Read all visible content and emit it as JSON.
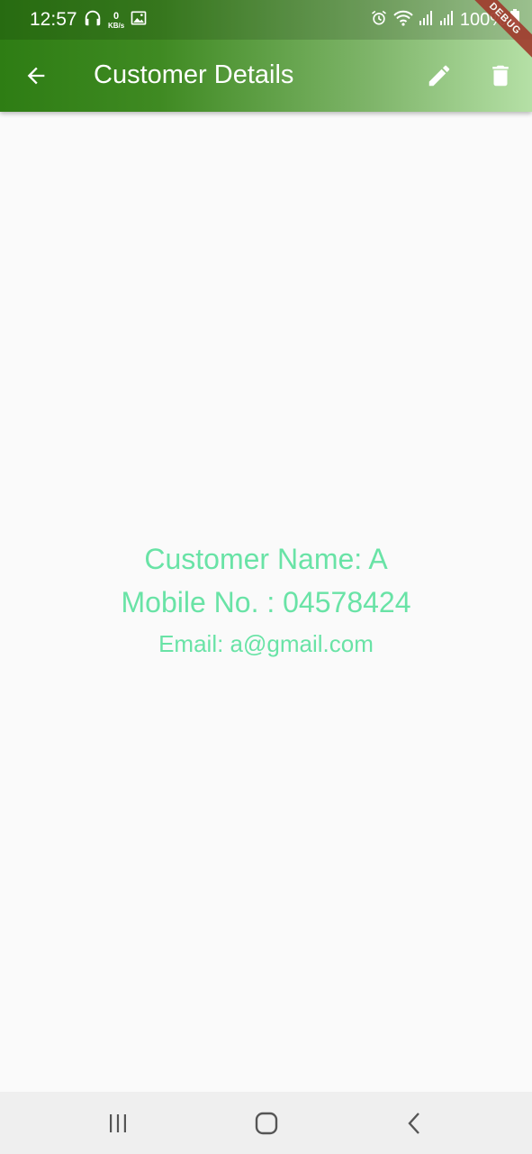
{
  "status_bar": {
    "time": "12:57",
    "network_speed_value": "0",
    "network_speed_unit": "KB/s",
    "battery_percent": "100%",
    "icons": [
      "headphones-icon",
      "network-speed-indicator",
      "image-notification-icon",
      "alarm-icon",
      "wifi-icon",
      "signal-icon",
      "battery-icon"
    ]
  },
  "debug_banner": "DEBUG",
  "app_bar": {
    "title": "Customer Details",
    "back_icon": "arrow-back-icon",
    "actions": [
      "edit-icon",
      "delete-icon"
    ]
  },
  "customer": {
    "name_line": "Customer Name: A",
    "mobile_line": "Mobile No. : 04578424",
    "email_line": "Email: a@gmail.com"
  },
  "nav_bar": {
    "buttons": [
      "recents-icon",
      "home-icon",
      "back-icon"
    ]
  },
  "colors": {
    "app_bar_gradient_start": "#2e7d14",
    "app_bar_gradient_end": "#b5e0a6",
    "detail_text": "#69e3a6",
    "background": "#fafafa"
  }
}
